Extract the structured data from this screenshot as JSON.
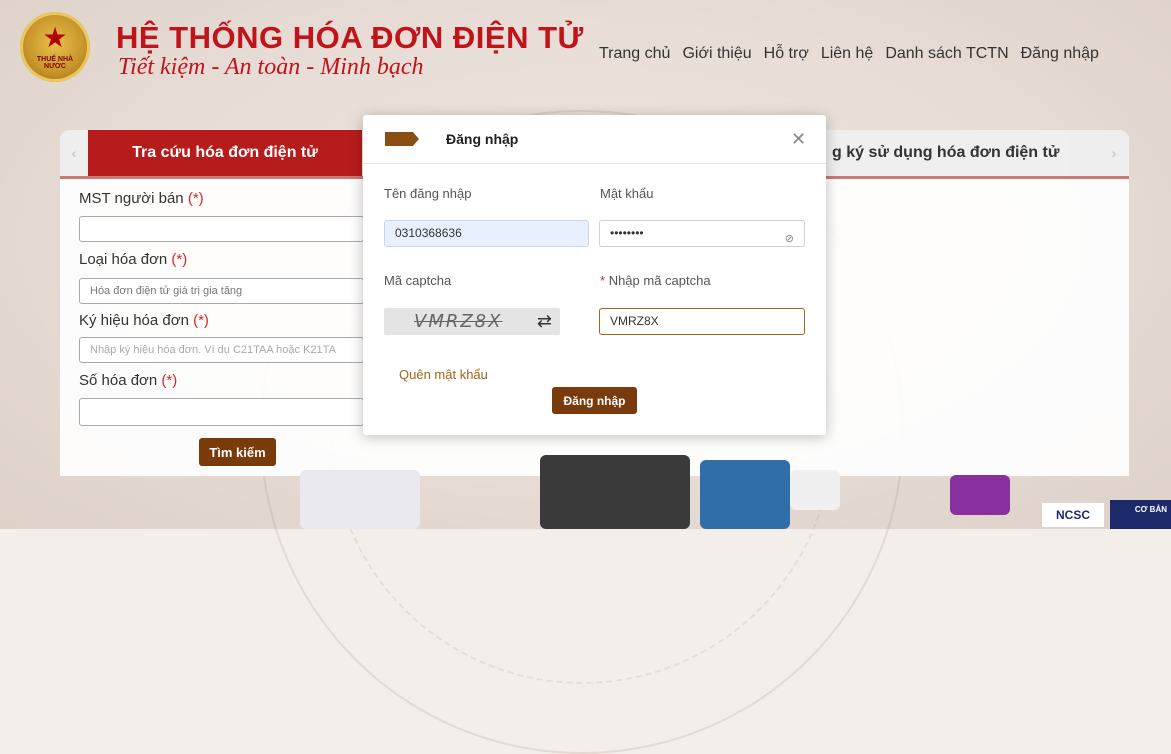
{
  "header": {
    "title": "HỆ THỐNG HÓA ĐƠN ĐIỆN TỬ",
    "subtitle": "Tiết kiệm - An toàn - Minh bạch",
    "emblem_text": "THUẾ NHÀ NƯỚC",
    "nav": [
      "Trang chủ",
      "Giới thiệu",
      "Hỗ trợ",
      "Liên hệ",
      "Danh sách TCTN",
      "Đăng nhập"
    ]
  },
  "tabs": {
    "active_label": "Tra cứu hóa đơn điện tử",
    "right_label": "g ký sử dụng hóa đơn điện tử",
    "prev_icon": "chevron-left-icon",
    "next_icon": "chevron-right-icon"
  },
  "search_form": {
    "seller_tax_label": "MST người bán",
    "invoice_type_label": "Loại hóa đơn",
    "invoice_type_value": "Hóa đơn điện tử giá trị gia tăng",
    "symbol_label": "Ký hiệu hóa đơn",
    "symbol_placeholder": "Nhập ký hiệu hóa đơn. Ví dụ C21TAA hoặc K21TA",
    "number_label": "Số hóa đơn",
    "required_mark": "(*)",
    "search_button": "Tìm kiếm"
  },
  "login_modal": {
    "title": "Đăng nhập",
    "close_icon": "close-icon",
    "username_label": "Tên đăng nhập",
    "username_value": "0310368636",
    "password_label": "Mật khẩu",
    "password_value": "••••••••",
    "captcha_label": "Mã captcha",
    "captcha_text": "VMRZ8X",
    "captcha_input_label": "Nhập mã captcha",
    "captcha_required_mark": "*",
    "captcha_input_value": "VMRZ8X",
    "forgot_link": "Quên mật khẩu",
    "submit_button": "Đăng nhập"
  },
  "footer": {
    "ncsc_label": "NCSC",
    "badge_label": "CƠ BẢN"
  },
  "colors": {
    "brand_red": "#c0141b",
    "tab_red": "#b71c1c",
    "button_brown": "#7a3b0c",
    "link_brown": "#a0641c"
  }
}
